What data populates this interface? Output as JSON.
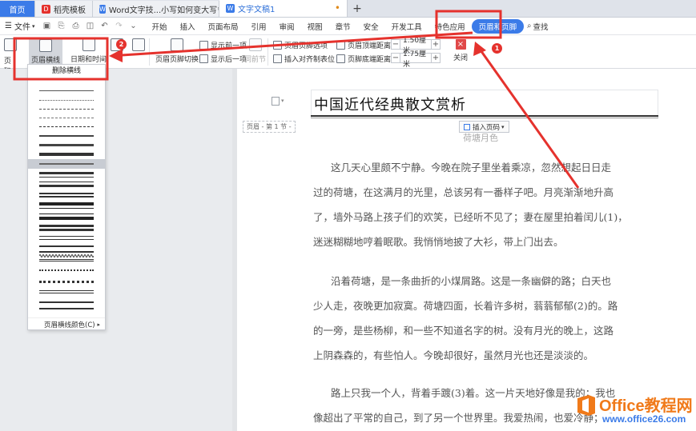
{
  "tabs": [
    {
      "label": "首页",
      "type": "home"
    },
    {
      "label": "稻壳模板",
      "type": "daoke",
      "icon_color": "#e5322d"
    },
    {
      "label": "Word文字技...小写如何变大写",
      "type": "doc",
      "icon_color": "#3b7be8"
    },
    {
      "label": "文字文稿1",
      "type": "doc-active",
      "icon_color": "#3b7be8"
    }
  ],
  "menubar": {
    "file_label": "文件",
    "items": [
      "开始",
      "插入",
      "页面布局",
      "引用",
      "审阅",
      "视图",
      "章节",
      "安全",
      "开发工具",
      "特色应用"
    ],
    "active_item": "页眉和页脚",
    "search_label": "查找"
  },
  "ribbon": {
    "page_label": "页码",
    "header_line_label": "页眉横线",
    "datetime_label": "日期和时间",
    "badge2": "2",
    "header_footer_switch": "页眉页脚切换",
    "show_prev": "显示前一项",
    "show_next": "显示后一项",
    "same_as_prev": "同前节",
    "hf_options": "页眉页脚选项",
    "insert_align_tab": "插入对齐制表位",
    "header_top_label": "页眉顶端距离:",
    "header_top_value": "1.50厘米",
    "footer_bottom_label": "页脚底端距离:",
    "footer_bottom_value": "1.75厘米",
    "close_label": "关闭",
    "badge1": "1"
  },
  "dropdown": {
    "delete_label": "删除横线",
    "color_label": "页眉横线颜色(C)"
  },
  "document": {
    "header_title": "中国近代经典散文赏析",
    "header_tag": "页眉 - 第 1 节 -",
    "insert_page_label": "插入页码",
    "body_fragment": "荷塘月色",
    "paragraphs": [
      [
        "这几天心里颇不宁静。今晚在院子里坐着乘凉，忽然想起日日走",
        "过的荷塘，在这满月的光里，总该另有一番样子吧。月亮渐渐地升高",
        "了，墙外马路上孩子们的欢笑，已经听不见了；妻在屋里拍着闰儿(1)，",
        "迷迷糊糊地哼着眠歌。我悄悄地披了大衫，带上门出去。"
      ],
      [
        "沿着荷塘，是一条曲折的小煤屑路。这是一条幽僻的路；白天也",
        "少人走，夜晚更加寂寞。荷塘四面，长着许多树，蓊蓊郁郁(2)的。路",
        "的一旁，是些杨柳，和一些不知道名字的树。没有月光的晚上，这路",
        "上阴森森的，有些怕人。今晚却很好，虽然月光也还是淡淡的。"
      ],
      [
        "路上只我一个人，背着手踱(3)着。这一片天地好像是我的；我也",
        "像超出了平常的自己，到了另一个世界里。我爱热闹，也爱冷静；爱"
      ]
    ]
  },
  "watermark": {
    "brand": "Office教程网",
    "url": "www.office26.com"
  },
  "colors": {
    "accent": "#3b7be8",
    "annotation": "#e5322d",
    "watermark_orange": "#f07a1a"
  }
}
